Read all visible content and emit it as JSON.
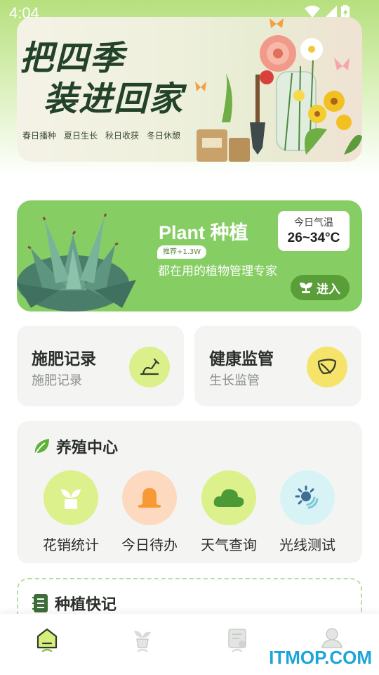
{
  "status_bar": {
    "time": "4:04"
  },
  "banner": {
    "title_line1": "把四季",
    "title_line2": "装进回家",
    "subtitles": [
      "春日播种",
      "夏日生长",
      "秋日收获",
      "冬日休憩"
    ]
  },
  "plant_card": {
    "title": "Plant 种植",
    "badge": "推荐+1.3W",
    "description": "都在用的植物管理专家",
    "temperature_label": "今日气温",
    "temperature_value": "26~34°C",
    "enter_label": "进入"
  },
  "records": [
    {
      "title": "施肥记录",
      "subtitle": "施肥记录",
      "icon": "shovel-icon",
      "color": "#dbef8a"
    },
    {
      "title": "健康监管",
      "subtitle": "生长监管",
      "icon": "leaf-icon",
      "color": "#f5e36a"
    }
  ],
  "breeding_center": {
    "title": "养殖中心",
    "items": [
      {
        "label": "花销统计",
        "icon": "plant-pot-icon",
        "color": "#dcf08c"
      },
      {
        "label": "今日待办",
        "icon": "bell-icon",
        "color": "#fdd9bf"
      },
      {
        "label": "天气查询",
        "icon": "cloud-icon",
        "color": "#dcf08c"
      },
      {
        "label": "光线测试",
        "icon": "sun-icon",
        "color": "#d8f3f6"
      }
    ]
  },
  "quick_notes": {
    "title": "种植快记"
  },
  "bottom_nav": [
    {
      "name": "home",
      "icon": "home-icon",
      "active": true
    },
    {
      "name": "plants",
      "icon": "plant-icon",
      "active": false
    },
    {
      "name": "records",
      "icon": "notes-icon",
      "active": false
    },
    {
      "name": "profile",
      "icon": "user-icon",
      "active": false
    }
  ],
  "watermark": "ITMOP.COM",
  "colors": {
    "primary_green": "#86cd63",
    "dark_green": "#5a9e3a"
  }
}
